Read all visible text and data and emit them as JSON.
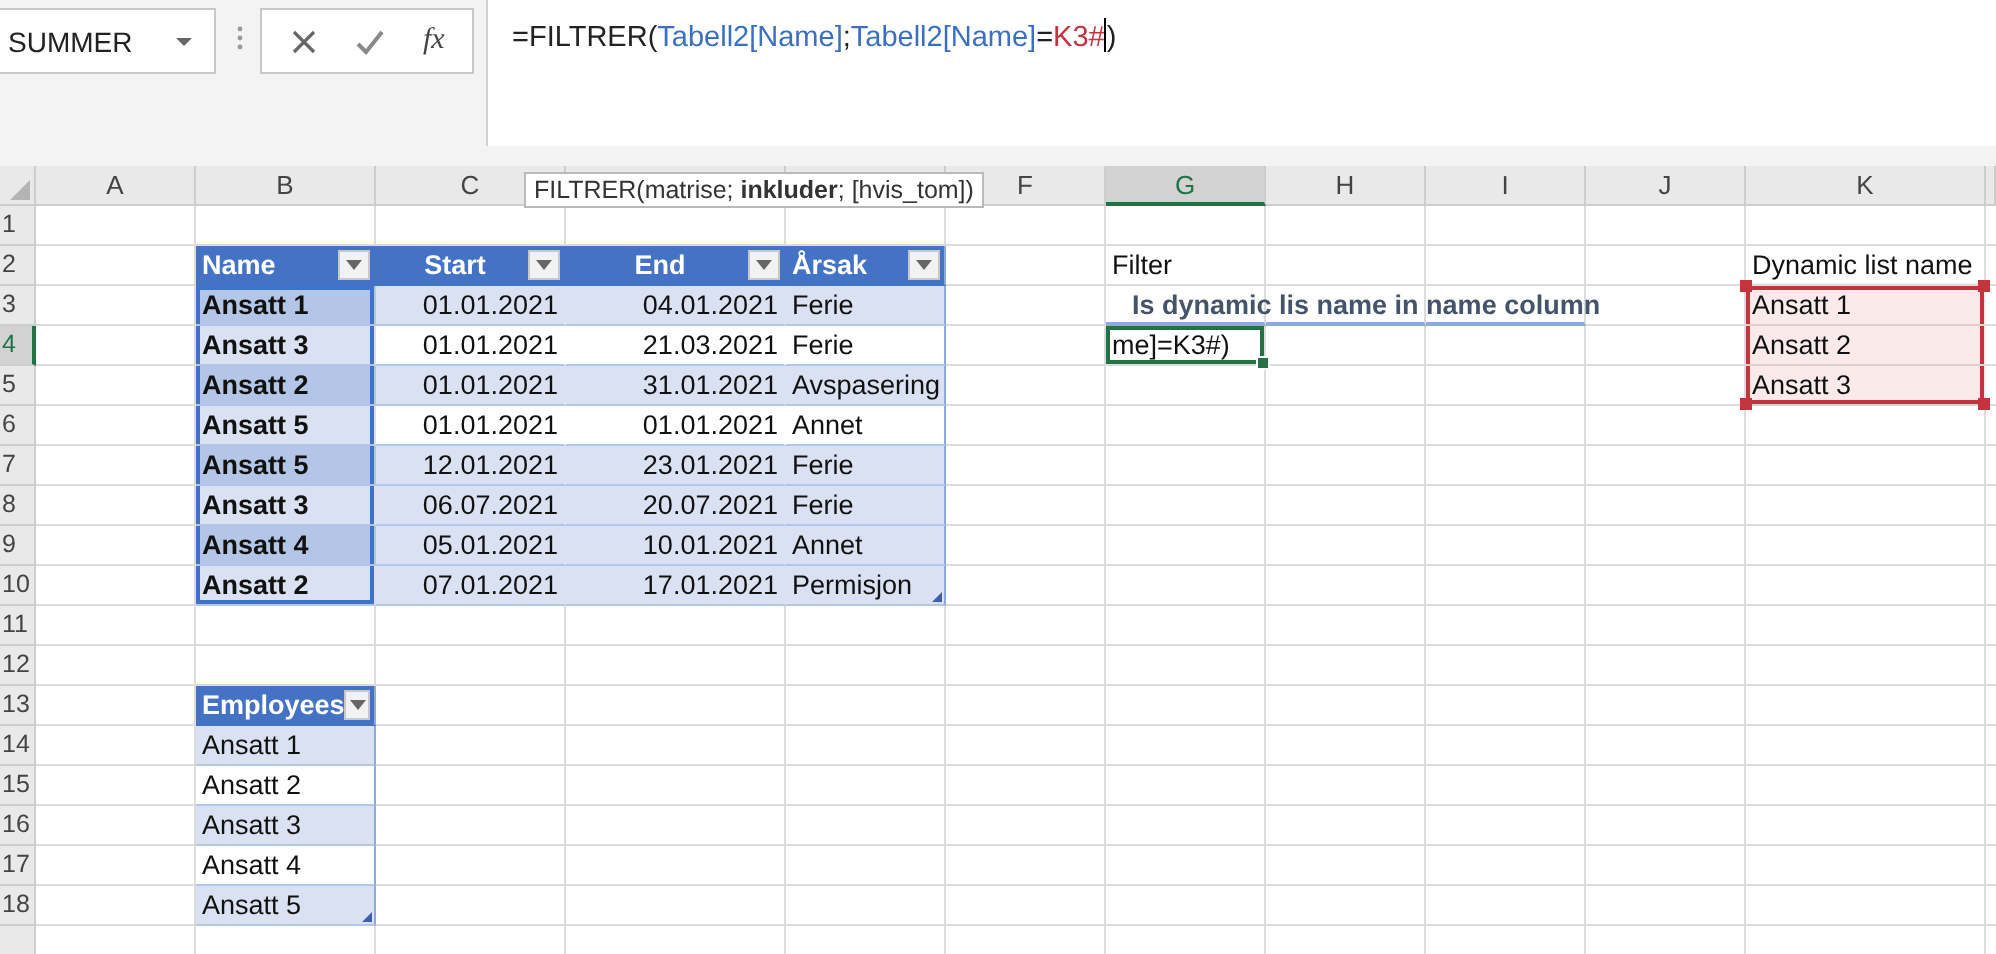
{
  "name_box": {
    "value": "SUMMER"
  },
  "function_button": "fx",
  "formula": [
    {
      "kind": "plain",
      "text": "=FILTRER("
    },
    {
      "kind": "ref",
      "text": "Tabell2[Name]"
    },
    {
      "kind": "plain",
      "text": ";"
    },
    {
      "kind": "ref",
      "text": "Tabell2[Name]"
    },
    {
      "kind": "plain",
      "text": "="
    },
    {
      "kind": "range",
      "text": "K3#",
      "cursor": true
    },
    {
      "kind": "plain",
      "text": ")"
    }
  ],
  "tooltip": "FILTRER(matrise; **inkluder**; [hvis_tom])",
  "columns": [
    {
      "label": "A",
      "selected": false
    },
    {
      "label": "B",
      "selected": false
    },
    {
      "label": "C",
      "selected": false
    },
    {
      "selected": false
    },
    {
      "selected": false
    },
    {
      "label": "F",
      "selected": false
    },
    {
      "label": "G",
      "selected": true
    },
    {
      "label": "H",
      "selected": false
    },
    {
      "label": "I",
      "selected": false
    },
    {
      "label": "J",
      "selected": false
    },
    {
      "label": "K",
      "selected": false
    }
  ],
  "rows": [
    {
      "label": "1",
      "selected": false
    },
    {
      "label": "2",
      "selected": false
    },
    {
      "label": "3",
      "selected": false
    },
    {
      "label": "4",
      "selected": true
    },
    {
      "label": "5",
      "selected": false
    },
    {
      "label": "6",
      "selected": false
    },
    {
      "label": "7",
      "selected": false
    },
    {
      "label": "8",
      "selected": false
    },
    {
      "label": "9",
      "selected": false
    },
    {
      "label": "10",
      "selected": false
    },
    {
      "label": "11",
      "selected": false
    },
    {
      "label": "12",
      "selected": false
    },
    {
      "label": "13",
      "selected": false
    },
    {
      "label": "14",
      "selected": false
    },
    {
      "label": "15",
      "selected": false
    },
    {
      "label": "16",
      "selected": false
    },
    {
      "label": "17",
      "selected": false
    },
    {
      "label": "18",
      "selected": false
    }
  ],
  "table": {
    "columns": [
      {
        "label": "Name",
        "kind": "name"
      },
      {
        "label": "Start",
        "kind": "date"
      },
      {
        "label": "End",
        "kind": "date"
      },
      {
        "label": "Årsak",
        "kind": "text"
      }
    ],
    "rows": [
      {
        "cells": [
          "Ansatt 1",
          "01.01.2021",
          "04.01.2021",
          "Ferie"
        ],
        "shaded": true,
        "name_dark": true
      },
      {
        "cells": [
          "Ansatt 3",
          "01.01.2021",
          "21.03.2021",
          "Ferie"
        ],
        "shaded": false,
        "name_dark": false
      },
      {
        "cells": [
          "Ansatt 2",
          "01.01.2021",
          "31.01.2021",
          "Avspasering"
        ],
        "shaded": true,
        "name_dark": true
      },
      {
        "cells": [
          "Ansatt 5",
          "01.01.2021",
          "01.01.2021",
          "Annet"
        ],
        "shaded": false,
        "name_dark": false
      },
      {
        "cells": [
          "Ansatt 5",
          "12.01.2021",
          "23.01.2021",
          "Ferie"
        ],
        "shaded": true,
        "name_dark": true
      },
      {
        "cells": [
          "Ansatt 3",
          "06.07.2021",
          "20.07.2021",
          "Ferie"
        ],
        "shaded": true,
        "name_dark": false
      },
      {
        "cells": [
          "Ansatt 4",
          "05.01.2021",
          "10.01.2021",
          "Annet"
        ],
        "shaded": true,
        "name_dark": true
      },
      {
        "cells": [
          "Ansatt 2",
          "07.01.2021",
          "17.01.2021",
          "Permisjon"
        ],
        "shaded": true,
        "name_dark": false
      }
    ]
  },
  "employees": {
    "column": "Employees",
    "rows": [
      {
        "value": "Ansatt 1",
        "shaded": true
      },
      {
        "value": "Ansatt 2",
        "shaded": false
      },
      {
        "value": "Ansatt 3",
        "shaded": true
      },
      {
        "value": "Ansatt 4",
        "shaded": false
      },
      {
        "value": "Ansatt 5",
        "shaded": true
      }
    ]
  },
  "filter": {
    "label": "Filter",
    "note": "Is dynamic lis name in name column",
    "editing_text": "me]=K3#)"
  },
  "dynamic_list": {
    "label": "Dynamic list name",
    "items": [
      "Ansatt 1",
      "Ansatt 2",
      "Ansatt 3"
    ]
  }
}
